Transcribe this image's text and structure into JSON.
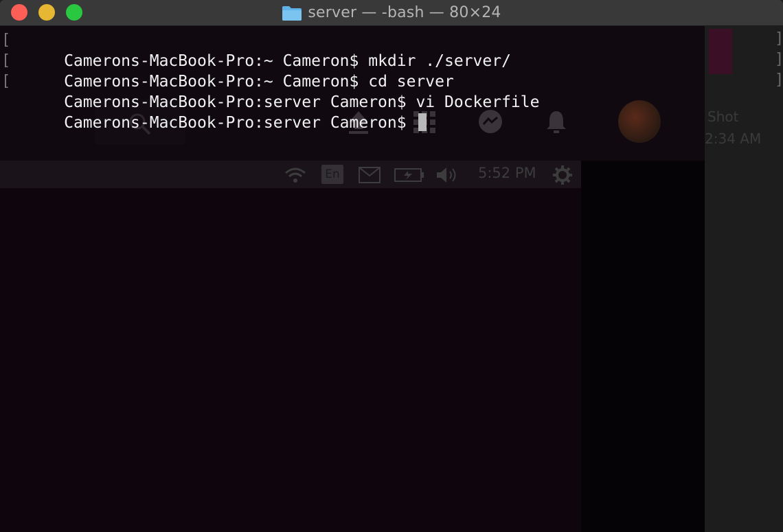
{
  "window": {
    "title": "server — -bash — 80×24"
  },
  "terminal": {
    "lines": [
      {
        "prompt": "Camerons-MacBook-Pro:~ Cameron$",
        "command": "mkdir ./server/"
      },
      {
        "prompt": "Camerons-MacBook-Pro:~ Cameron$",
        "command": "cd server"
      },
      {
        "prompt": "Camerons-MacBook-Pro:server Cameron$",
        "command": "vi Dockerfile"
      },
      {
        "prompt": "Camerons-MacBook-Pro:server Cameron$",
        "command": ""
      }
    ]
  },
  "background": {
    "shot_label": "Shot",
    "shot_time": "2:34 AM",
    "panel_language": "En",
    "panel_clock": "5:52 PM"
  },
  "icons": {
    "title_folder": "folder-icon",
    "bg_search": "search-icon",
    "bg_upload": "upload-icon",
    "bg_apps": "apps-grid-icon",
    "bg_messenger": "messenger-icon",
    "bg_notifications": "bell-icon",
    "bg_record": "record-icon",
    "bg_wifi": "wifi-icon",
    "bg_mail": "mail-icon",
    "bg_battery": "battery-icon",
    "bg_volume": "volume-icon",
    "bg_settings": "gear-icon"
  },
  "colors": {
    "close": "#fd5f57",
    "minimize": "#e6b733",
    "maximize": "#2ac740",
    "terminal_bg": "#0b050b",
    "terminal_text": "#f2f2f2"
  }
}
